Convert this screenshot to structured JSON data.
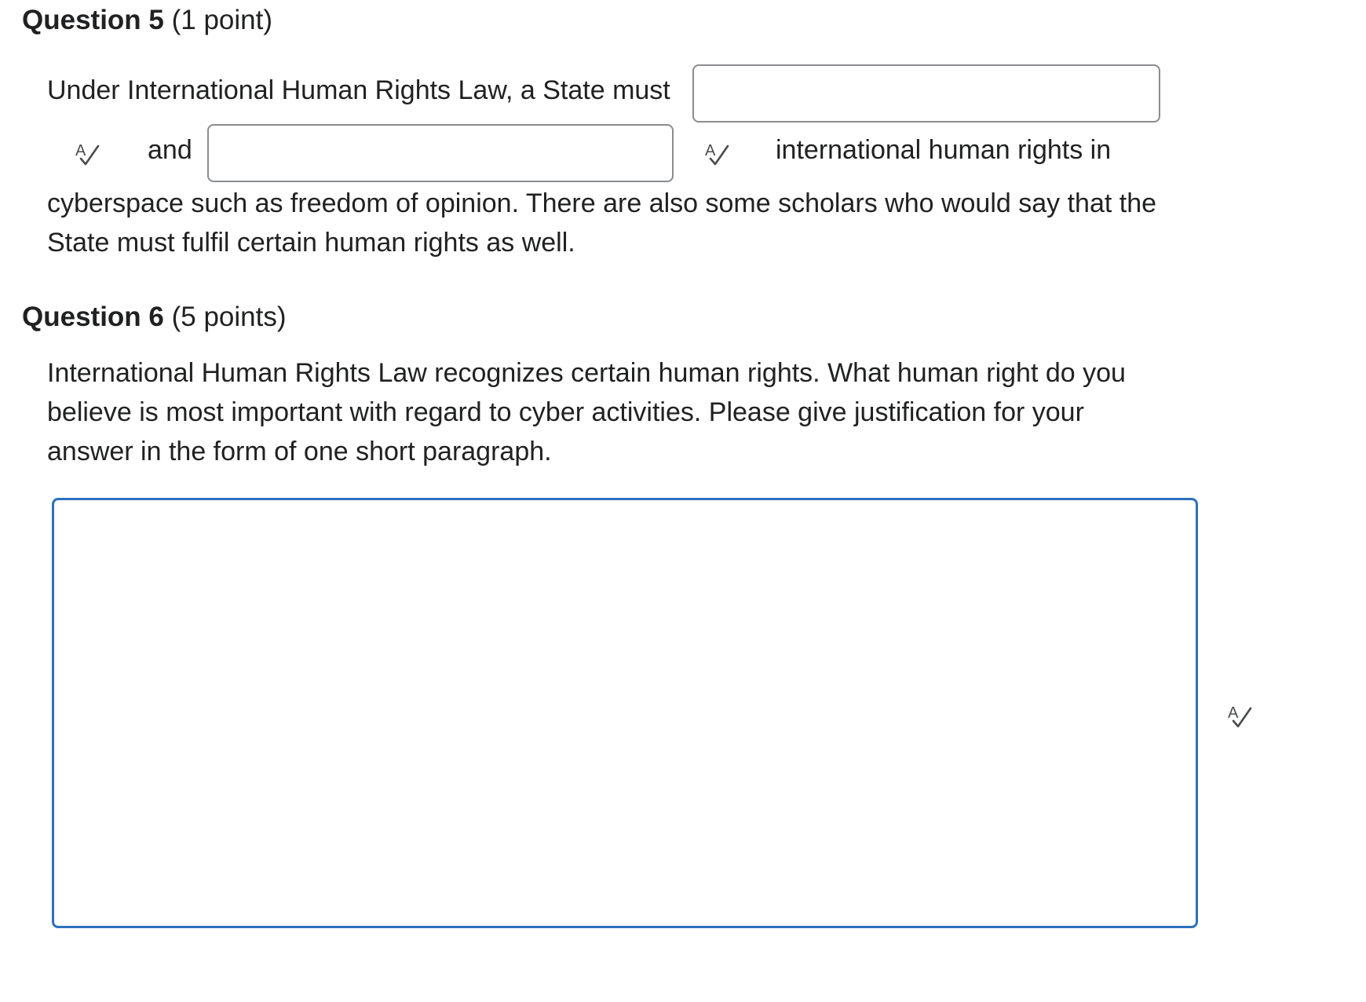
{
  "question5": {
    "title": "Question 5",
    "points": "(1 point)",
    "line1": "Under International Human Rights Law, a State must",
    "connector": "and",
    "after_blanks": "international human rights in",
    "line3": "cyberspace such as freedom of opinion.  There are also some scholars who would say that the",
    "line4": "State must fulfil certain human rights as well.",
    "blank1_value": "",
    "blank2_value": ""
  },
  "question6": {
    "title": "Question 6",
    "points": "(5 points)",
    "line1": "International Human Rights Law recognizes certain human rights.  What human right do you",
    "line2": "believe is most important with regard to cyber activities.  Please give justification for your",
    "line3": "answer in the form of one short paragraph.",
    "essay_value": ""
  },
  "icons": {
    "spell_check": "spell-check-icon"
  },
  "colors": {
    "text": "#202122",
    "input_border": "#8a8c8f",
    "focus_border": "#2d70bf"
  }
}
